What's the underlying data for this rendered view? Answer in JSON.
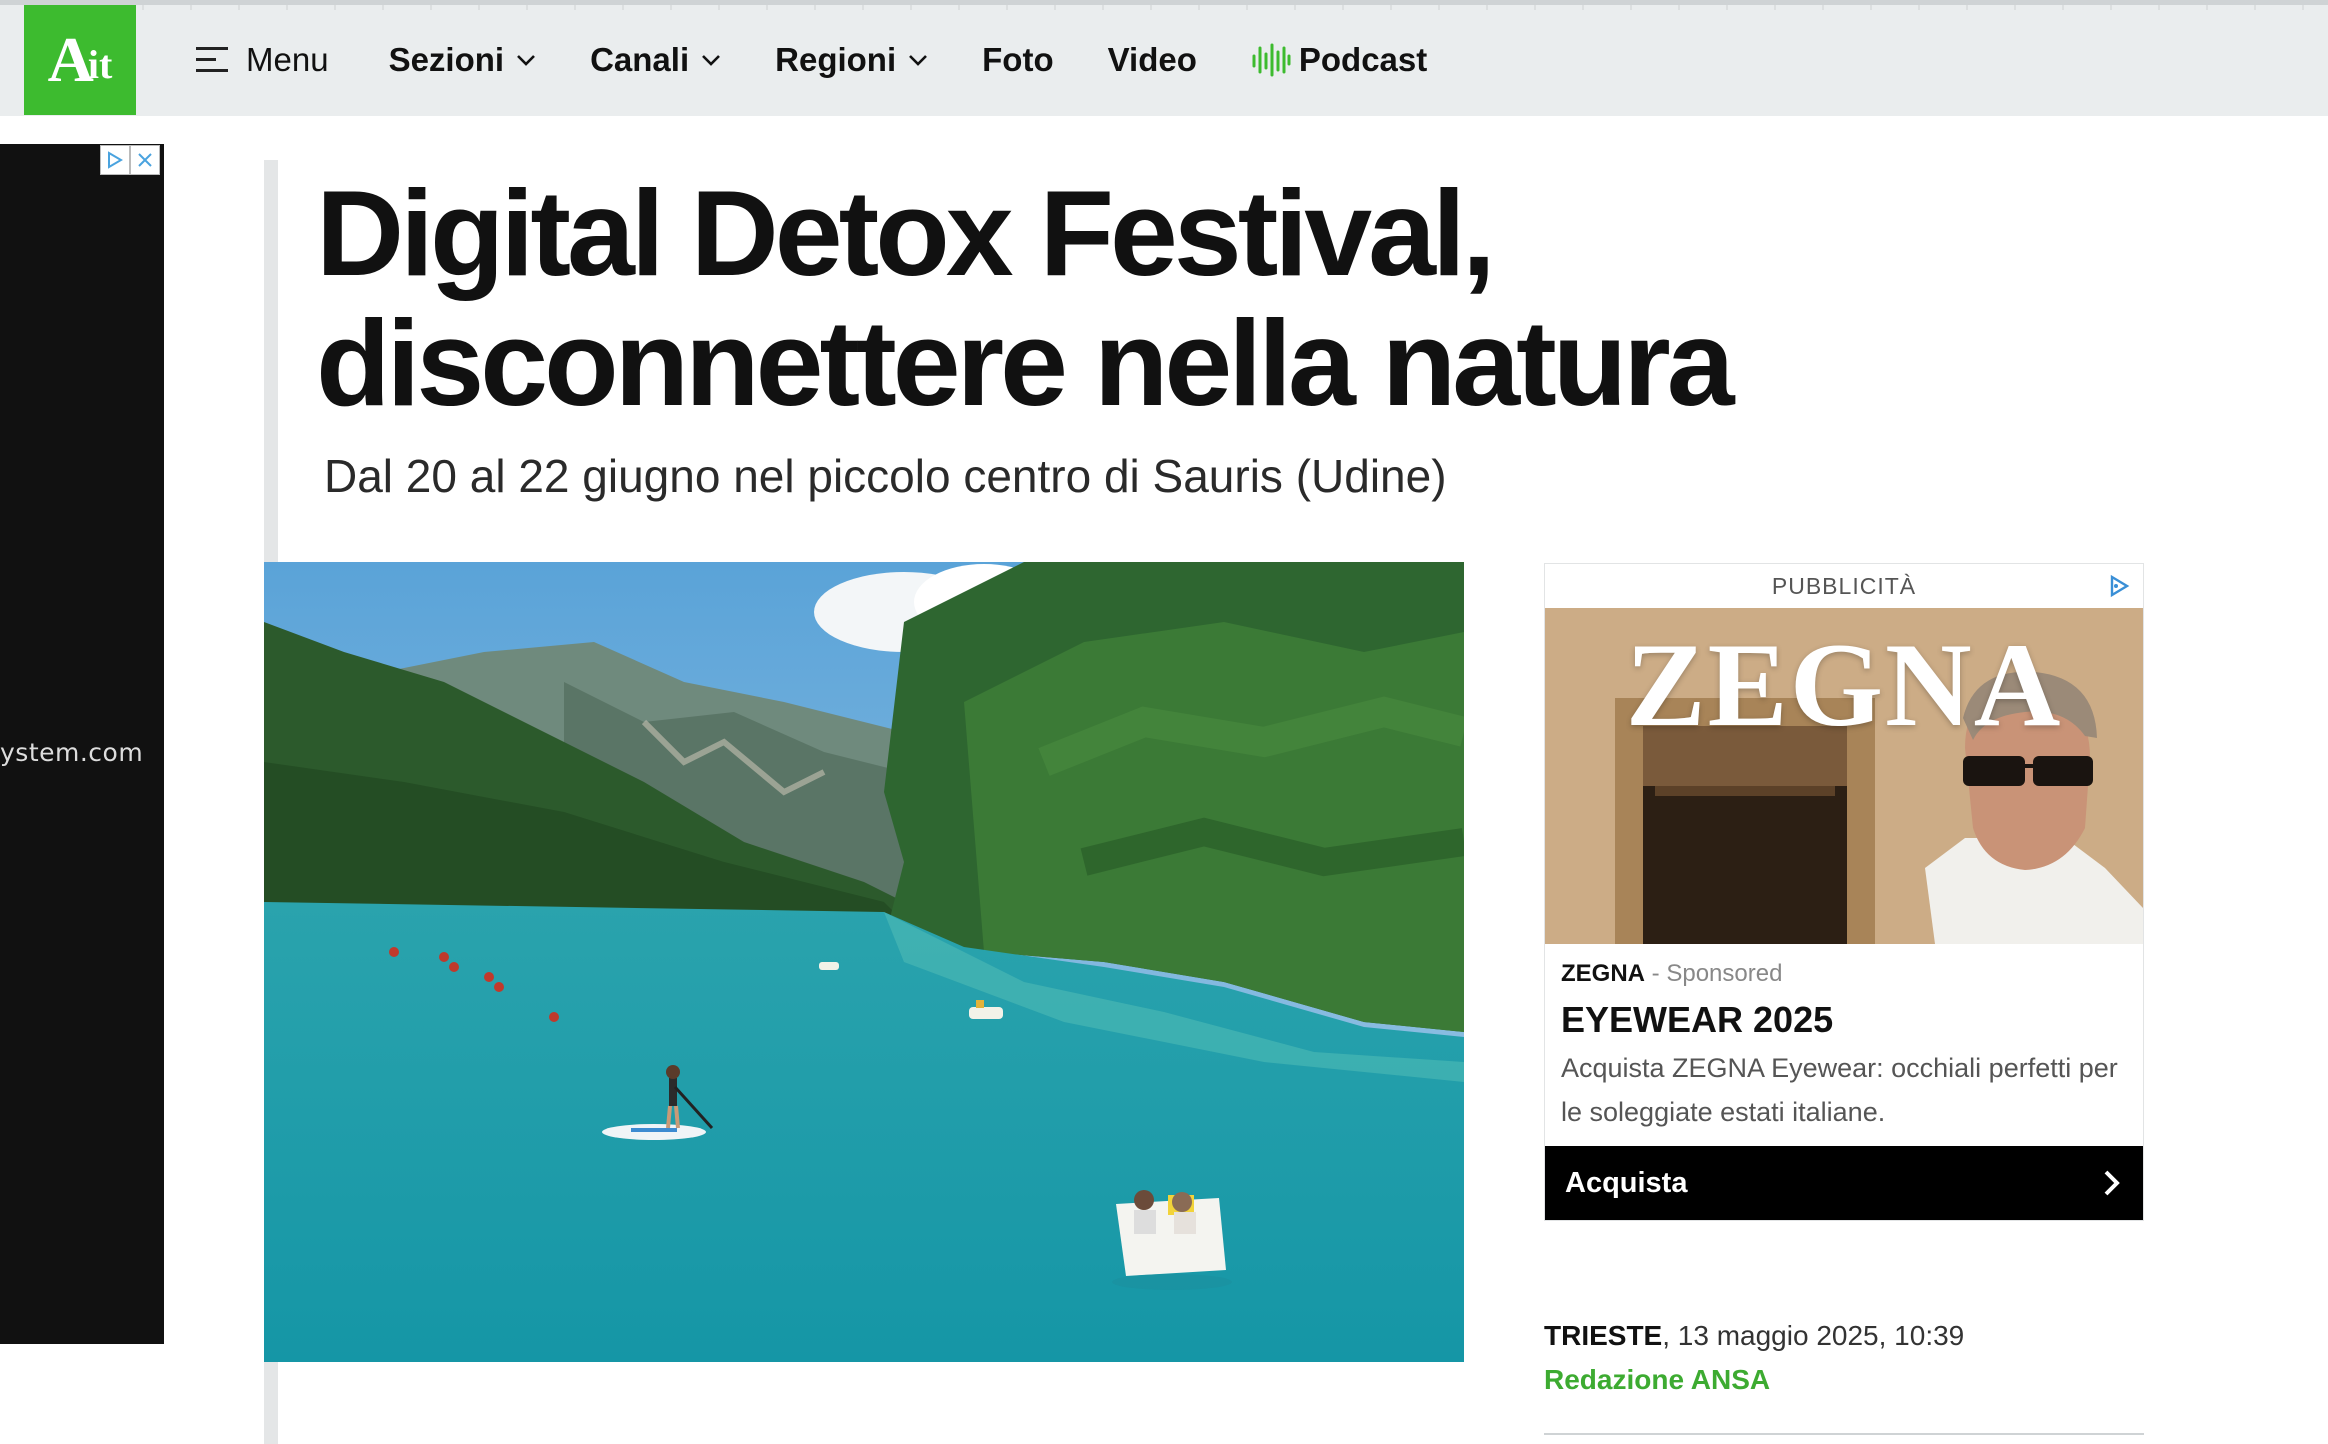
{
  "nav": {
    "logo_big": "A",
    "logo_small": "it",
    "menu_label": "Menu",
    "items": [
      {
        "label": "Sezioni",
        "has_dropdown": true
      },
      {
        "label": "Canali",
        "has_dropdown": true
      },
      {
        "label": "Regioni",
        "has_dropdown": true
      },
      {
        "label": "Foto",
        "has_dropdown": false
      },
      {
        "label": "Video",
        "has_dropdown": false
      }
    ],
    "podcast_label": "Podcast",
    "colors": {
      "brand": "#3dbb2f",
      "bar_bg": "#eaedee"
    }
  },
  "left_ad": {
    "text": "ystem.com",
    "controls": [
      "adchoices-icon",
      "close-icon"
    ]
  },
  "article": {
    "headline_line1": "Digital Detox Festival,",
    "headline_line2": "disconnettere nella natura",
    "subhead": "Dal 20 al 22 giugno nel piccolo centro di Sauris (Udine)",
    "hero_alt": "lake-with-paddleboards-and-pedal-boats"
  },
  "sponsor": {
    "label": "PUBBLICITÀ",
    "image_word": "ZEGNA",
    "brand": "ZEGNA",
    "sponsored": "- Sponsored",
    "title": "EYEWEAR 2025",
    "description": "Acquista ZEGNA Eyewear: occhiali perfetti per le soleggiate estati italiane.",
    "cta": "Acquista"
  },
  "meta": {
    "location": "TRIESTE",
    "datetime": ", 13 maggio 2025, 10:39",
    "author": "Redazione ANSA",
    "author_color": "#3dab31"
  }
}
